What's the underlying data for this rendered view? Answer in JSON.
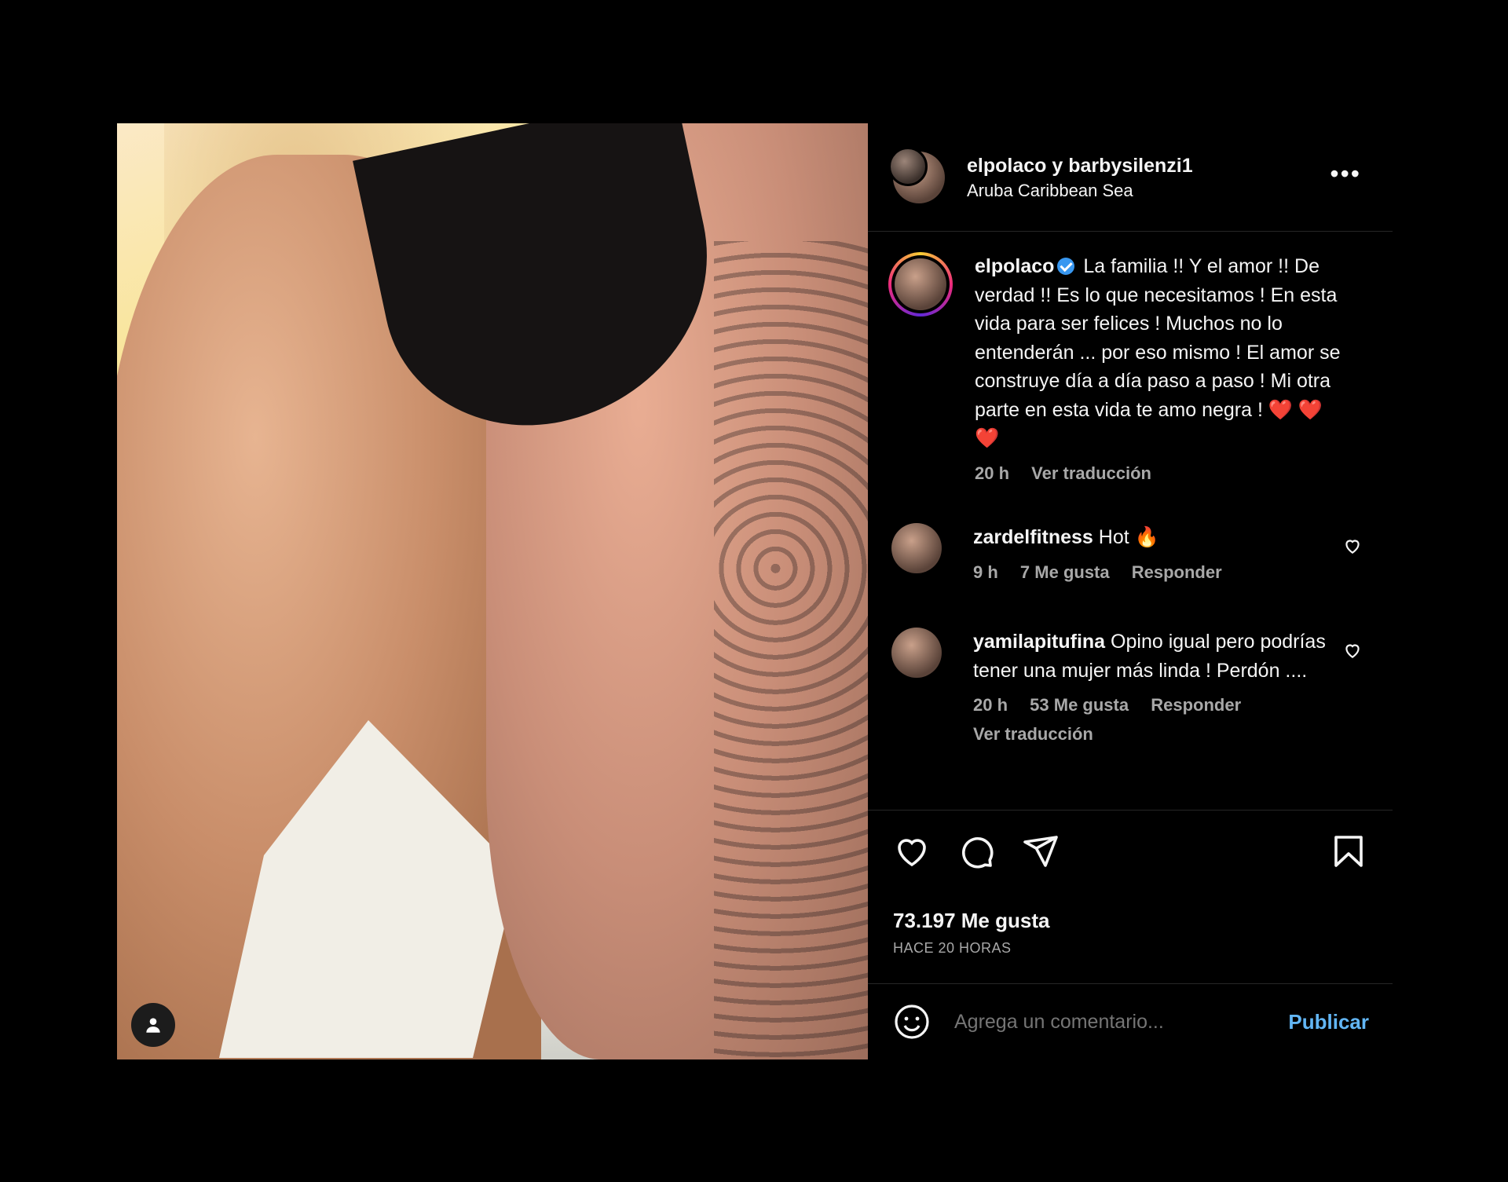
{
  "header": {
    "title": "elpolaco y barbysilenzi1",
    "location": "Aruba Caribbean Sea",
    "more_icon": "more-icon"
  },
  "caption": {
    "username": "elpolaco",
    "text": "La familia !! Y el amor !! De verdad !! Es lo que necesitamos ! En esta vida para ser felices ! Muchos no lo entenderán ... por eso mismo ! El amor se construye día a día paso a paso ! Mi otra parte en esta vida te amo negra !",
    "hearts": "❤️ ❤️ ❤️",
    "time": "20 h",
    "translate": "Ver traducción"
  },
  "comments": [
    {
      "username": "zardelfitness",
      "text": "Hot 🔥",
      "time": "9 h",
      "likes": "7 Me gusta",
      "reply": "Responder"
    },
    {
      "username": "yamilapitufina",
      "text": "Opino igual pero podrías tener una mujer más linda ! Perdón ....",
      "time": "20 h",
      "likes": "53 Me gusta",
      "reply": "Responder",
      "translate": "Ver traducción"
    }
  ],
  "likes": {
    "count": "73.197 Me gusta",
    "when": "HACE 20 HORAS"
  },
  "add_comment": {
    "placeholder": "Agrega un comentario...",
    "publish": "Publicar"
  },
  "colors": {
    "background": "#000000",
    "divider": "#262626",
    "secondary_text": "#a8a8a8",
    "link_blue": "#62b6f5",
    "verified_blue": "#3897f0",
    "heart_red": "#e0102a"
  }
}
